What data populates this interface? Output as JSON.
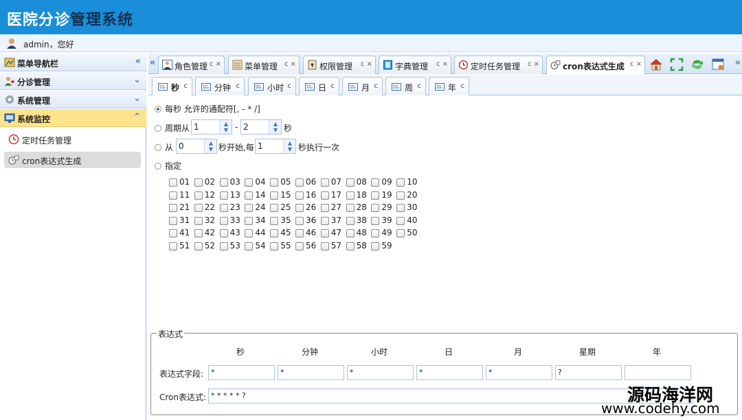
{
  "app": {
    "title_part1": "医院分诊",
    "title_part2": "管理系统"
  },
  "user": {
    "greeting": "admin，您好"
  },
  "sidebar": {
    "header": "菜单导航栏",
    "groups": [
      {
        "label": "分诊管理"
      },
      {
        "label": "系统管理"
      },
      {
        "label": "系统监控"
      }
    ],
    "items": [
      {
        "label": "定时任务管理"
      },
      {
        "label": "cron表达式生成"
      }
    ]
  },
  "tabs": [
    {
      "label": "角色管理",
      "ctl": "c ×"
    },
    {
      "label": "菜单管理",
      "ctl": "c ×"
    },
    {
      "label": "权限管理",
      "ctl": "c ×"
    },
    {
      "label": "字典管理",
      "ctl": "c ×"
    },
    {
      "label": "定时任务管理",
      "ctl": "c ×"
    },
    {
      "label": "cron表达式生成",
      "ctl": "c ×"
    }
  ],
  "subtabs": [
    {
      "label": "秒"
    },
    {
      "label": "分钟"
    },
    {
      "label": "小时"
    },
    {
      "label": "日"
    },
    {
      "label": "月"
    },
    {
      "label": "周"
    },
    {
      "label": "年"
    }
  ],
  "subtab_refresh": "c",
  "seconds": {
    "opt_every": "每秒 允许的通配符[, - * /]",
    "opt_period": "周期从",
    "period_from": "1",
    "period_dash": "-",
    "period_to": "2",
    "period_unit": "秒",
    "opt_from": "从",
    "from_value": "0",
    "from_mid": "秒开始,每",
    "every_value": "1",
    "from_end": "秒执行一次",
    "opt_specify": "指定",
    "checks": [
      "01",
      "02",
      "03",
      "04",
      "05",
      "06",
      "07",
      "08",
      "09",
      "10",
      "11",
      "12",
      "13",
      "14",
      "15",
      "16",
      "17",
      "18",
      "19",
      "20",
      "21",
      "22",
      "23",
      "24",
      "25",
      "26",
      "27",
      "28",
      "29",
      "30",
      "31",
      "32",
      "33",
      "34",
      "35",
      "36",
      "37",
      "38",
      "39",
      "40",
      "41",
      "42",
      "43",
      "44",
      "45",
      "46",
      "47",
      "48",
      "49",
      "50",
      "51",
      "52",
      "53",
      "54",
      "55",
      "56",
      "57",
      "58",
      "59"
    ]
  },
  "expression": {
    "legend": "表达式",
    "cols": [
      "秒",
      "分钟",
      "小时",
      "日",
      "月",
      "星期",
      "年"
    ],
    "field_label": "表达式字段:",
    "fields": [
      "*",
      "*",
      "*",
      "*",
      "*",
      "?",
      ""
    ],
    "cron_label": "Cron表达式:",
    "cron_value": "* * * * * ?"
  },
  "watermark": {
    "cn": "源码海洋网",
    "en": "www.codehy.com"
  }
}
